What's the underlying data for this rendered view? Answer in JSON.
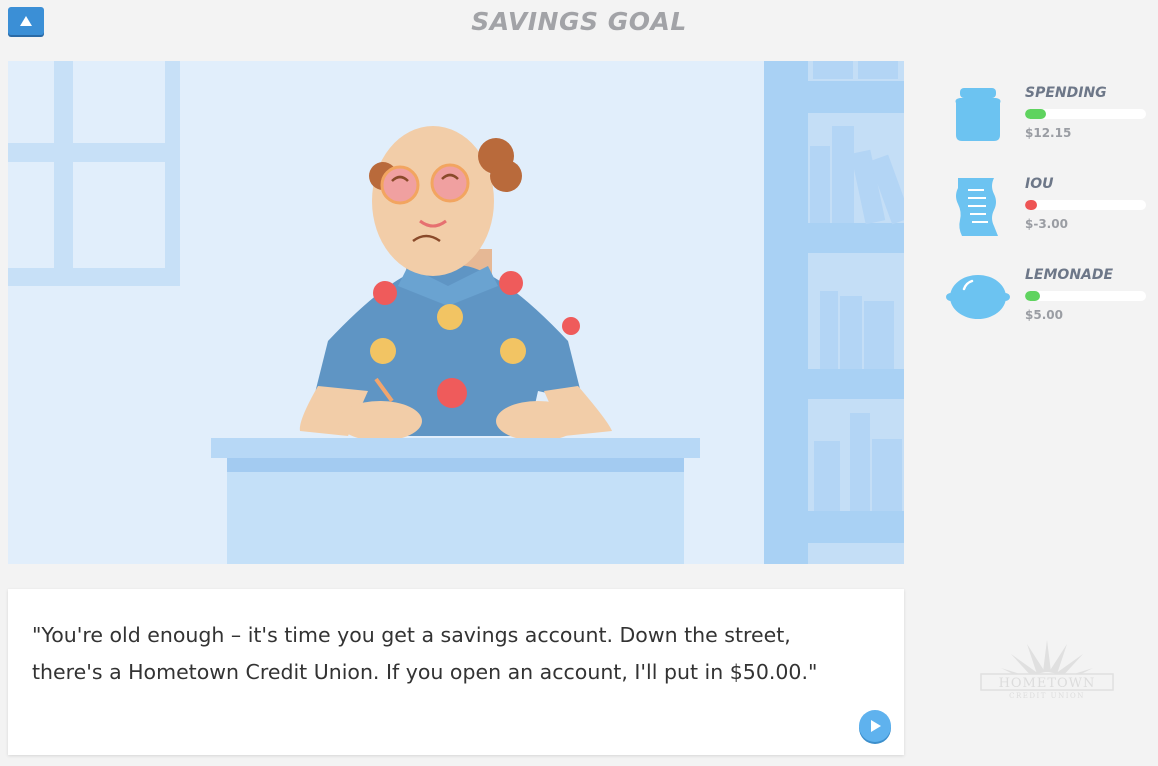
{
  "header": {
    "title": "SAVINGS GOAL",
    "nav_icon": "triangle-up-icon"
  },
  "scene": {
    "character": "elderly-man-in-hawaiian-shirt-writing"
  },
  "dialog": {
    "text": "\"You're old enough – it's time you get a savings account. Down the street, there's a Hometown Credit Union. If you open an account, I'll put in $50.00.\"",
    "play_icon": "play-icon"
  },
  "stats": [
    {
      "label": "SPENDING",
      "value": "$12.15",
      "icon": "jar-icon",
      "level": 0.17,
      "color": "#5fd35f"
    },
    {
      "label": "IOU",
      "value": "$-3.00",
      "icon": "receipt-icon",
      "level": 0.1,
      "color": "#ee5555"
    },
    {
      "label": "LEMONADE",
      "value": "$5.00",
      "icon": "lemon-icon",
      "level": 0.12,
      "color": "#5fd35f"
    }
  ],
  "logo": {
    "line1": "HOMETOWN",
    "line2": "CREDIT UNION"
  },
  "colors": {
    "accent": "#3b8fd6",
    "icon_blue": "#6cc3f1",
    "scene_bg": "#e1eefb"
  }
}
